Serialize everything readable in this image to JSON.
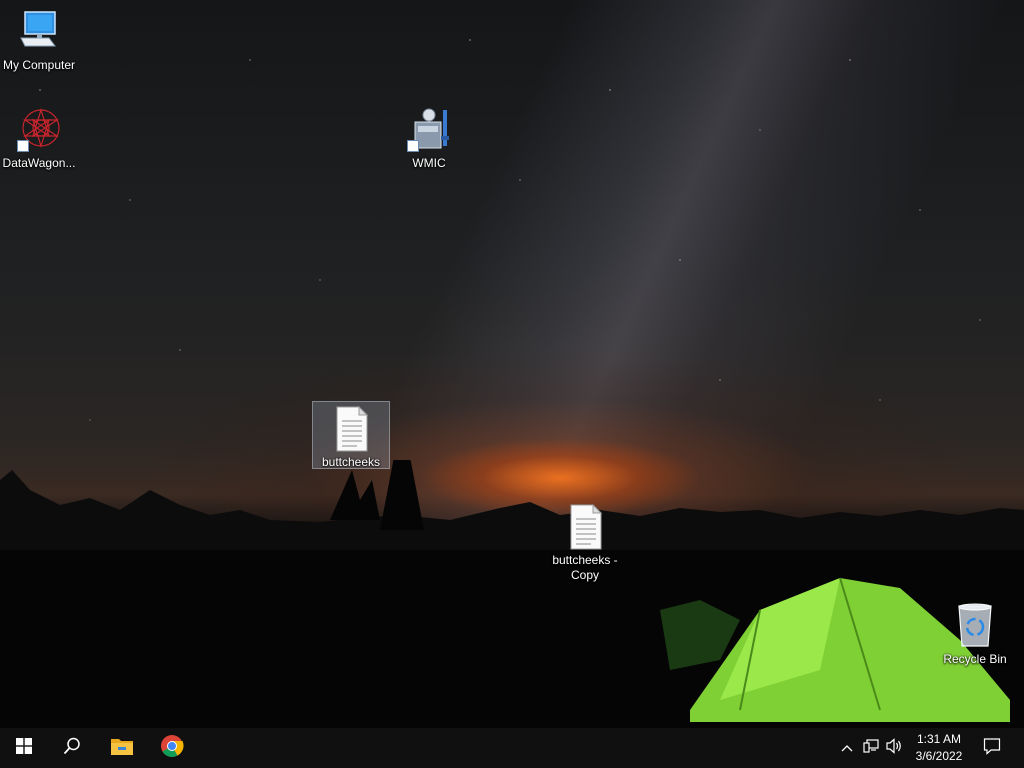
{
  "desktop": {
    "icons": [
      {
        "label": "My Computer",
        "icon": "computer-icon"
      },
      {
        "label": "DataWagon...",
        "icon": "datawagon-icon"
      },
      {
        "label": "WMIC",
        "icon": "wmic-icon"
      },
      {
        "label": "buttcheeks",
        "icon": "text-file-icon",
        "selected": true
      },
      {
        "label": "buttcheeks - Copy",
        "icon": "text-file-icon"
      },
      {
        "label": "Recycle Bin",
        "icon": "recycle-bin-icon"
      }
    ]
  },
  "taskbar": {
    "buttons": [
      "windows-start-icon",
      "search-icon",
      "file-explorer-icon",
      "chrome-icon"
    ],
    "tray": {
      "icons": [
        "chevron-up-icon",
        "network-icon",
        "volume-icon",
        "notification-icon"
      ],
      "time": "1:31 AM",
      "date": "3/6/2022"
    }
  },
  "colors": {
    "taskbar_bg": "#101010",
    "selection": "#a0b4c8",
    "explorer_yellow": "#f5c242",
    "tent_green": "#8fe03a"
  }
}
